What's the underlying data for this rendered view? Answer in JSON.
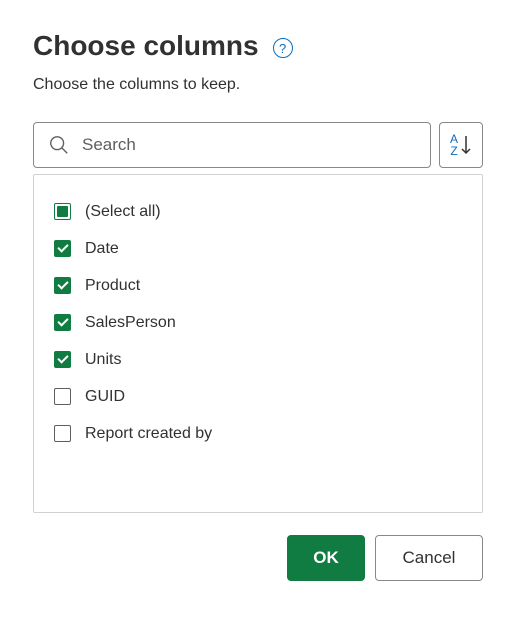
{
  "header": {
    "title": "Choose columns",
    "help_glyph": "?",
    "subtitle": "Choose the columns to keep."
  },
  "search": {
    "placeholder": "Search",
    "value": ""
  },
  "sort": {
    "letter_top": "A",
    "letter_bottom": "Z"
  },
  "columns": [
    {
      "label": "(Select all)",
      "state": "indeterminate"
    },
    {
      "label": "Date",
      "state": "checked"
    },
    {
      "label": "Product",
      "state": "checked"
    },
    {
      "label": "SalesPerson",
      "state": "checked"
    },
    {
      "label": "Units",
      "state": "checked"
    },
    {
      "label": "GUID",
      "state": "unchecked"
    },
    {
      "label": "Report created by",
      "state": "unchecked"
    }
  ],
  "buttons": {
    "ok": "OK",
    "cancel": "Cancel"
  }
}
